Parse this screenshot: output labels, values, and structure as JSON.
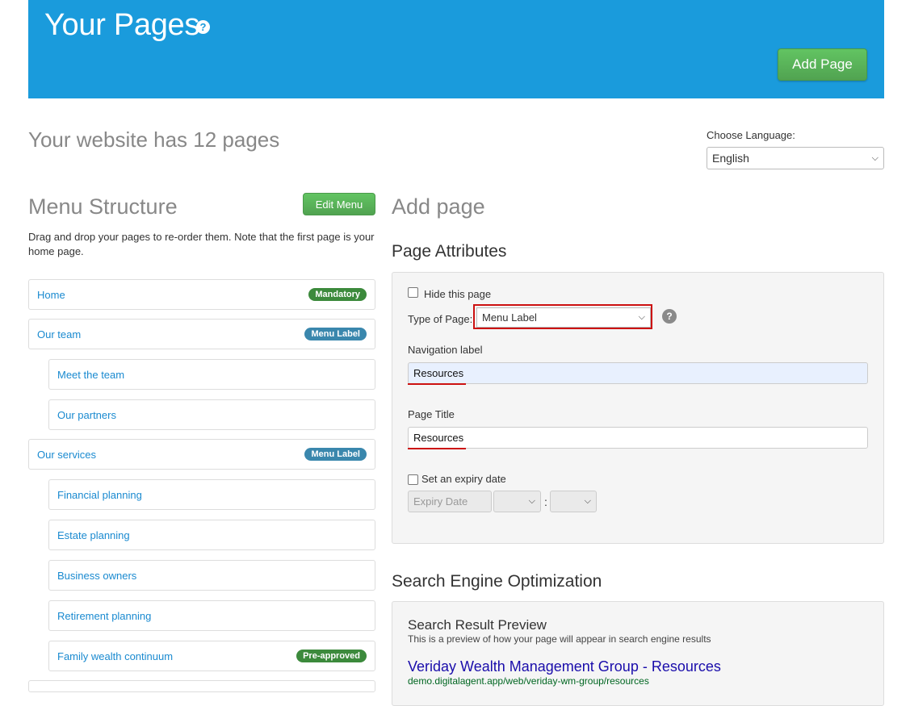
{
  "header": {
    "title": "Your Pages",
    "help_icon": "?",
    "add_page_label": "Add Page"
  },
  "summary": {
    "site_count_text": "Your website has 12 pages",
    "language_label": "Choose Language:",
    "language_value": "English"
  },
  "menu": {
    "heading": "Menu Structure",
    "edit_label": "Edit Menu",
    "description": "Drag and drop your pages to re-order them. Note that the first page is your home page.",
    "items": [
      {
        "label": "Home",
        "badge": "Mandatory",
        "badge_color": "#3c8a3c"
      },
      {
        "label": "Our team",
        "badge": "Menu Label",
        "badge_color": "#3a87ad"
      },
      {
        "label": "Meet the team",
        "badge": ""
      },
      {
        "label": "Our partners",
        "badge": ""
      },
      {
        "label": "Our services",
        "badge": "Menu Label",
        "badge_color": "#3a87ad"
      },
      {
        "label": "Financial planning",
        "badge": ""
      },
      {
        "label": "Estate planning",
        "badge": ""
      },
      {
        "label": "Business owners",
        "badge": ""
      },
      {
        "label": "Retirement planning",
        "badge": ""
      },
      {
        "label": "Family wealth continuum",
        "badge": "Pre-approved",
        "badge_color": "#3c8a3c"
      }
    ]
  },
  "add_page": {
    "heading": "Add page",
    "attributes_heading": "Page Attributes",
    "hide_label": "Hide this page",
    "hide_checked": false,
    "type_label": "Type of Page:",
    "type_value": "Menu Label",
    "help_icon": "?",
    "nav_label": "Navigation label",
    "nav_value": "Resources",
    "page_title_label": "Page Title",
    "page_title_value": "Resources",
    "expiry_label": "Set an expiry date",
    "expiry_checked": false,
    "expiry_placeholder": "Expiry Date",
    "time_separator": ":"
  },
  "seo": {
    "heading": "Search Engine Optimization",
    "preview_title": "Search Result Preview",
    "preview_desc": "This is a preview of how your page will appear in search engine results",
    "result_title": "Veriday Wealth Management Group - Resources",
    "result_url": "demo.digitalagent.app/web/veriday-wm-group/resources"
  },
  "colors": {
    "banner": "#1a9bdc",
    "primary_button": "#5cb85c",
    "link": "#1a8ad0",
    "highlight": "#cc1111"
  }
}
